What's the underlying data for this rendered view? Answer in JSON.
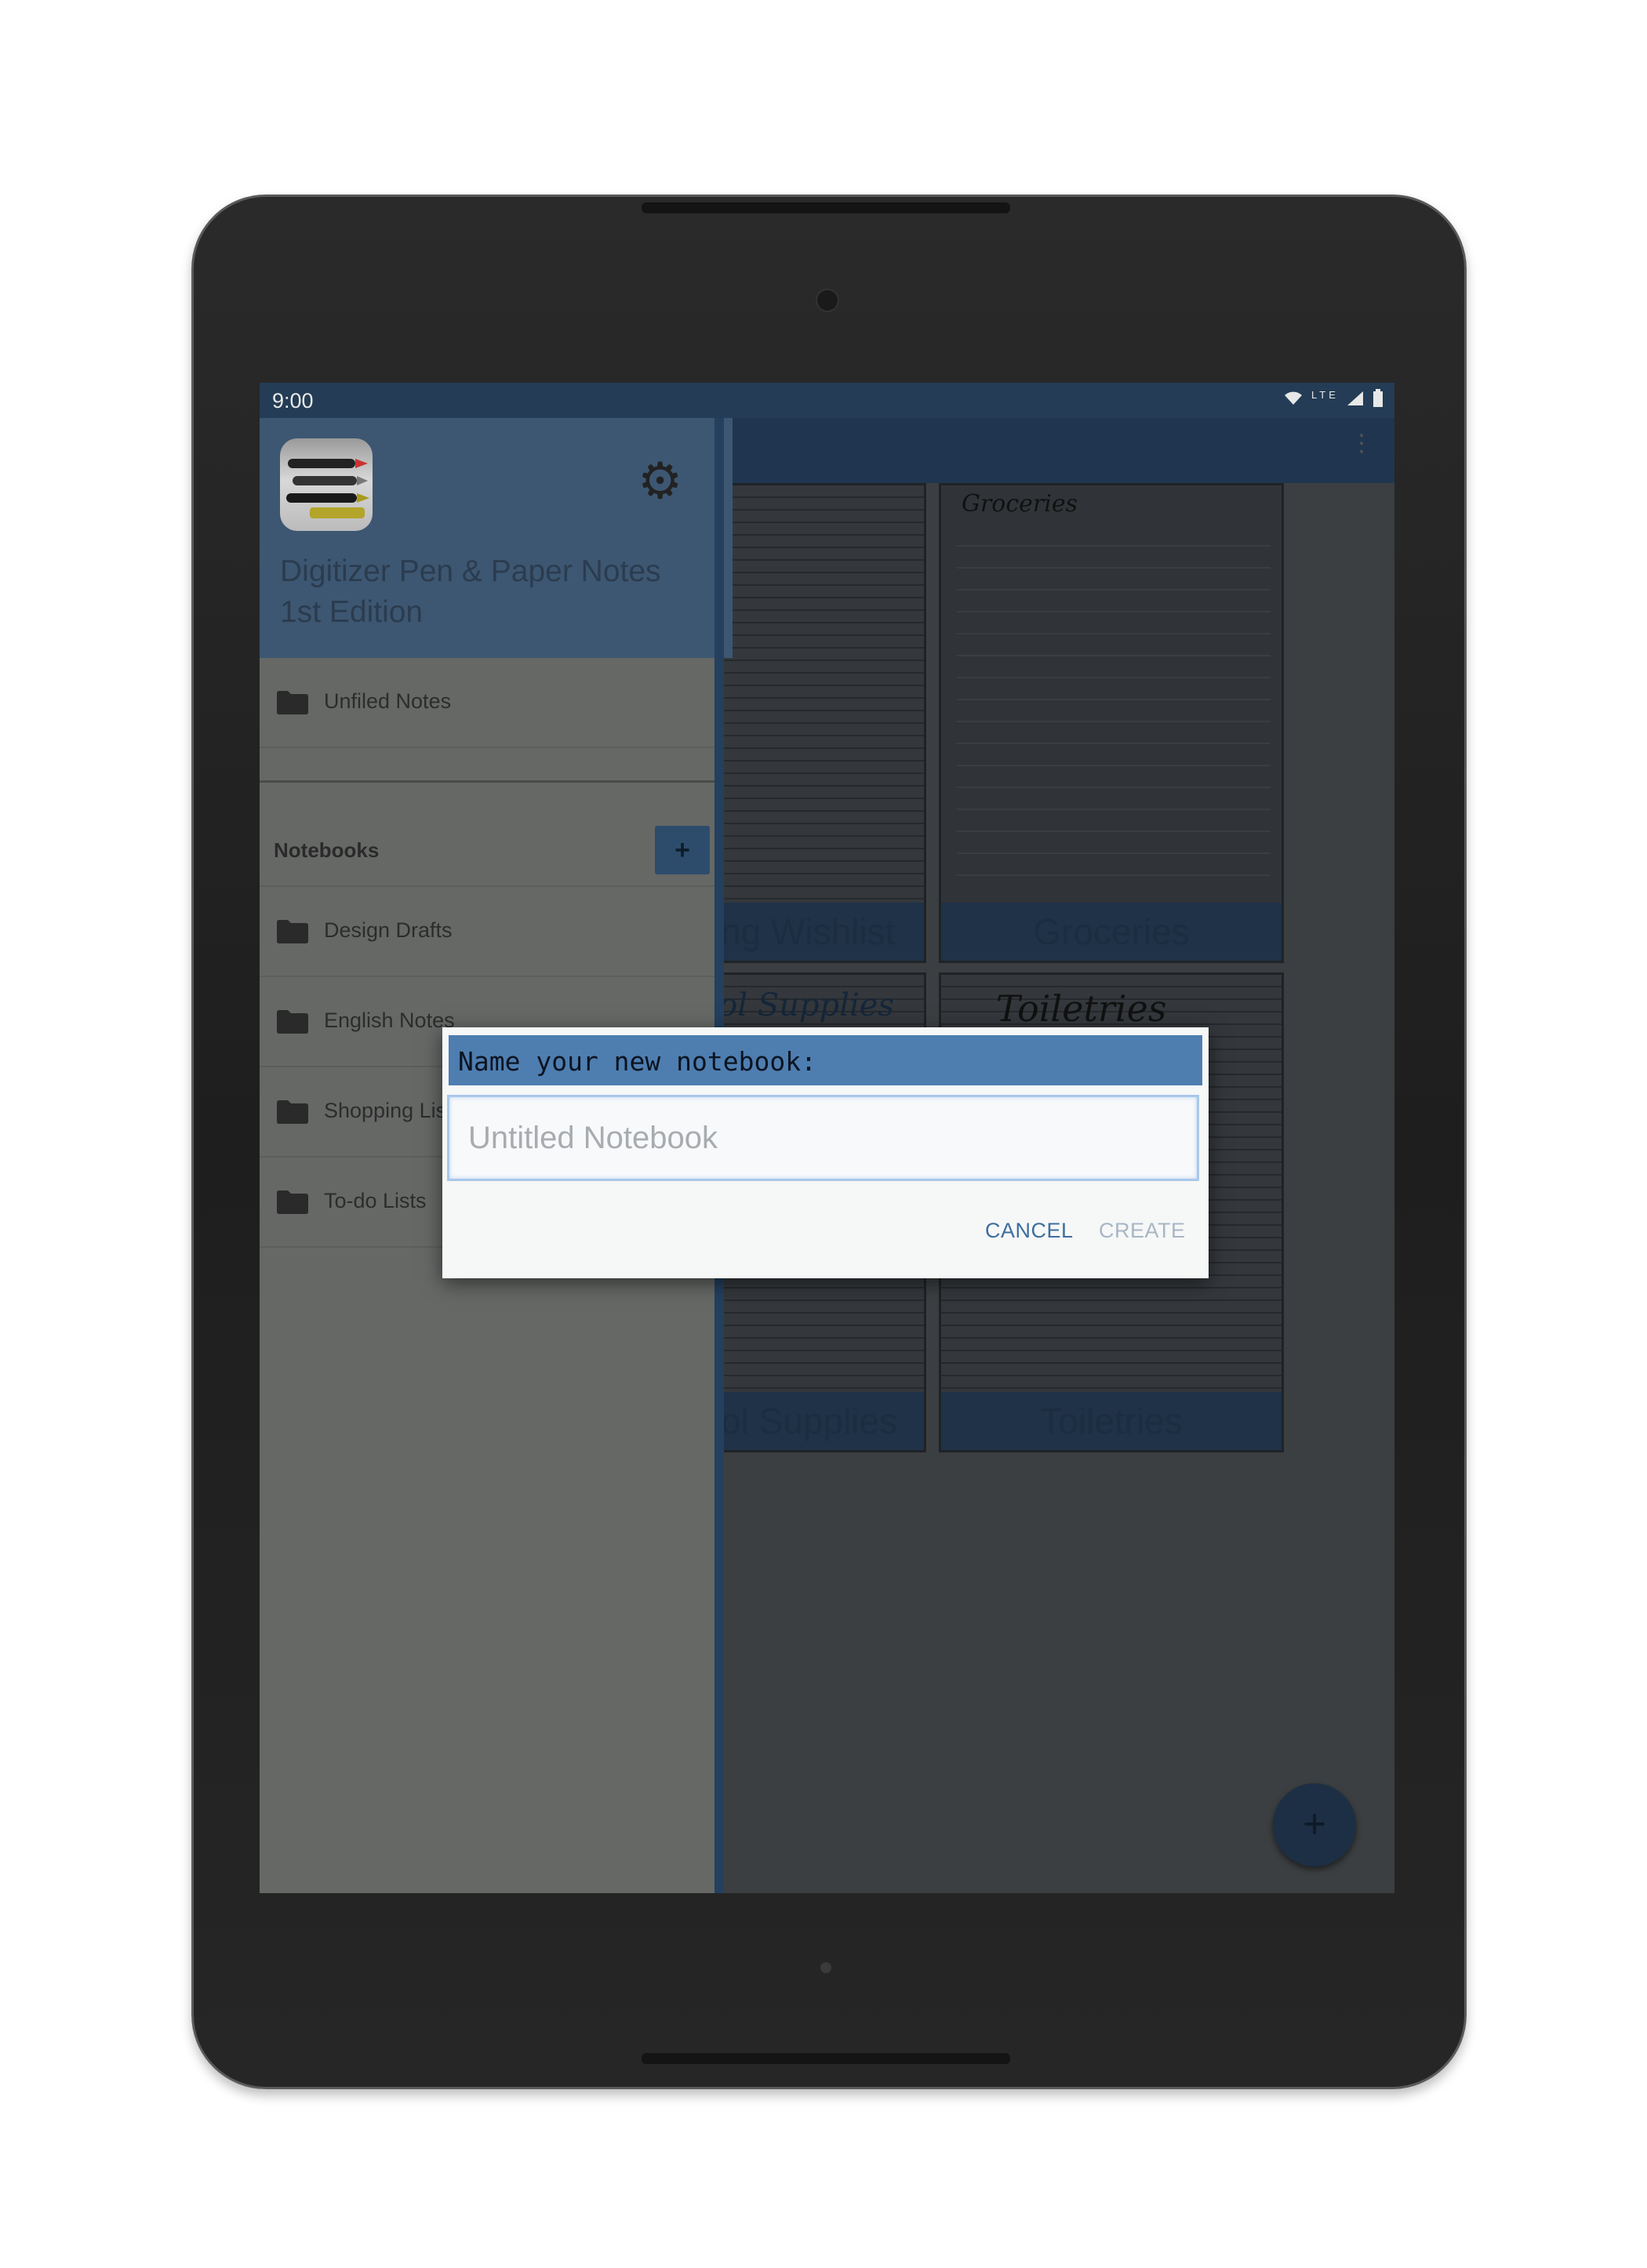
{
  "status_bar": {
    "time": "9:00",
    "network": "LTE"
  },
  "drawer": {
    "app_title_line1": "Digitizer Pen & Paper Notes",
    "app_title_line2": "1st Edition",
    "unfiled": "Unfiled Notes",
    "notebooks_header": "Notebooks",
    "add_label": "+",
    "notebooks": [
      "Design Drafts",
      "English Notes",
      "Shopping Lis",
      "To-do Lists"
    ]
  },
  "content": {
    "cards": [
      {
        "label": "ming Wishlist"
      },
      {
        "label": "Groceries",
        "handwriting": "Groceries"
      },
      {
        "label": "hool Supplies",
        "handwriting": "chool Supplies"
      },
      {
        "label": "Toiletries",
        "handwriting": "Toiletries"
      }
    ],
    "fab_label": "+"
  },
  "dialog": {
    "title": "Name your new notebook:",
    "placeholder": "Untitled Notebook",
    "value": "",
    "cancel": "CANCEL",
    "create": "CREATE"
  },
  "colors": {
    "dialog_title_bg": "#4e7db0",
    "accent": "#3f6f9e",
    "drawer_header": "#3d5772"
  }
}
